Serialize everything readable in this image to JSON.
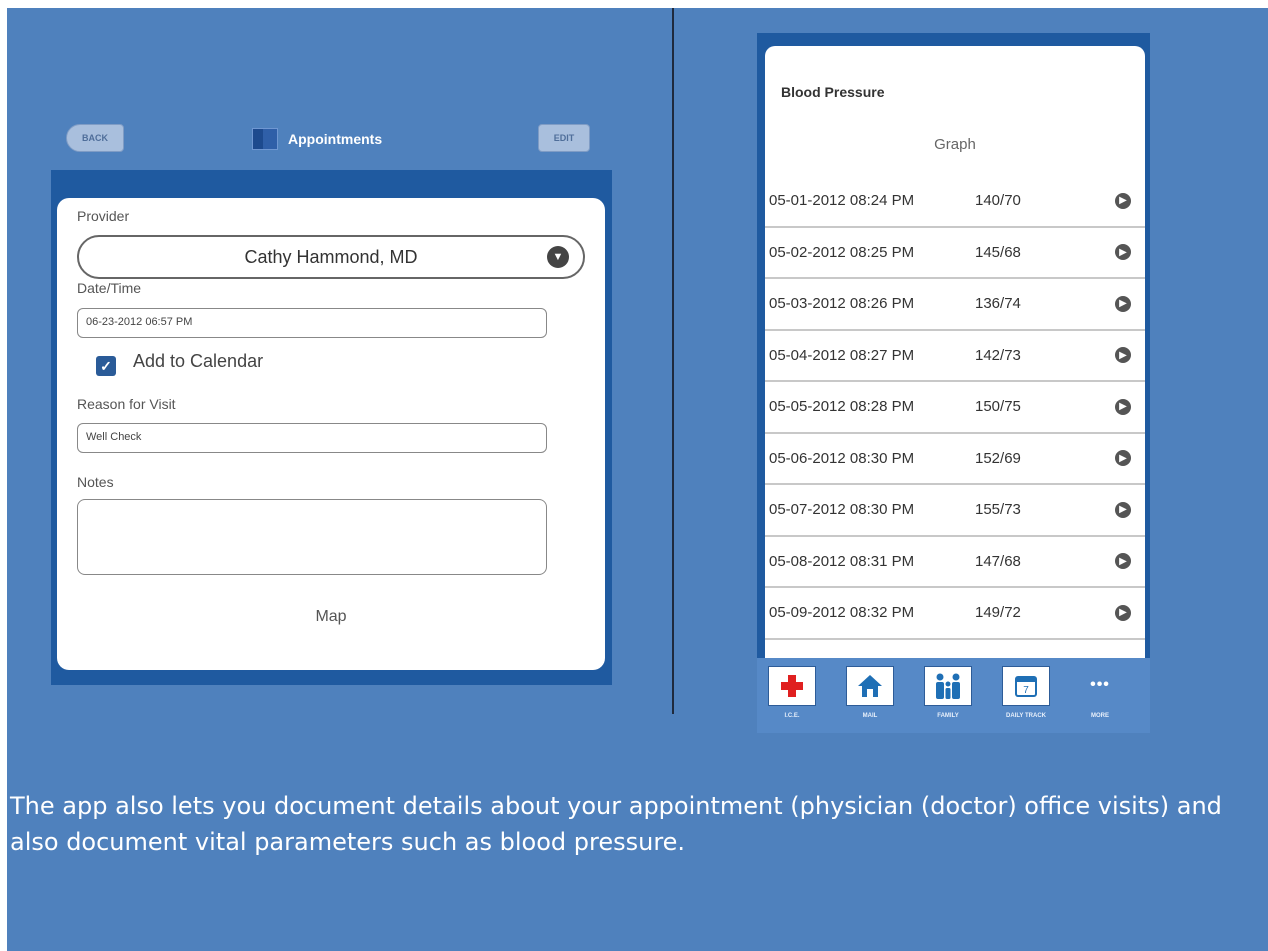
{
  "appointments": {
    "back_label": "BACK",
    "title": "Appointments",
    "edit_label": "EDIT",
    "provider_label": "Provider",
    "provider_value": "Cathy Hammond, MD",
    "datetime_label": "Date/Time",
    "datetime_value": "06-23-2012 06:57 PM",
    "add_to_calendar_label": "Add to Calendar",
    "add_to_calendar_checked": true,
    "reason_label": "Reason for Visit",
    "reason_value": "Well Check",
    "notes_label": "Notes",
    "notes_value": "",
    "map_label": "Map"
  },
  "blood_pressure": {
    "title": "Blood Pressure",
    "graph_label": "Graph",
    "readings": [
      {
        "datetime": "05-01-2012 08:24 PM",
        "value": "140/70"
      },
      {
        "datetime": "05-02-2012 08:25 PM",
        "value": "145/68"
      },
      {
        "datetime": "05-03-2012 08:26 PM",
        "value": "136/74"
      },
      {
        "datetime": "05-04-2012 08:27 PM",
        "value": "142/73"
      },
      {
        "datetime": "05-05-2012 08:28 PM",
        "value": "150/75"
      },
      {
        "datetime": "05-06-2012 08:30 PM",
        "value": "152/69"
      },
      {
        "datetime": "05-07-2012 08:30 PM",
        "value": "155/73"
      },
      {
        "datetime": "05-08-2012 08:31 PM",
        "value": "147/68"
      },
      {
        "datetime": "05-09-2012 08:32 PM",
        "value": "149/72"
      }
    ],
    "tabs": [
      {
        "label": "I.C.E.",
        "icon": "medical-cross-icon"
      },
      {
        "label": "MAIL",
        "icon": "home-icon"
      },
      {
        "label": "FAMILY",
        "icon": "family-icon"
      },
      {
        "label": "DAILY TRACK",
        "icon": "calendar-icon"
      },
      {
        "label": "MORE",
        "icon": "more-dots-icon"
      }
    ]
  },
  "caption": "The app also lets you document details about your appointment (physician (doctor) office visits) and also document vital parameters such as blood pressure.",
  "colors": {
    "slide_background": "#4f81bd",
    "phone_frame": "#1f5aa0",
    "accent_red": "#e02020"
  }
}
